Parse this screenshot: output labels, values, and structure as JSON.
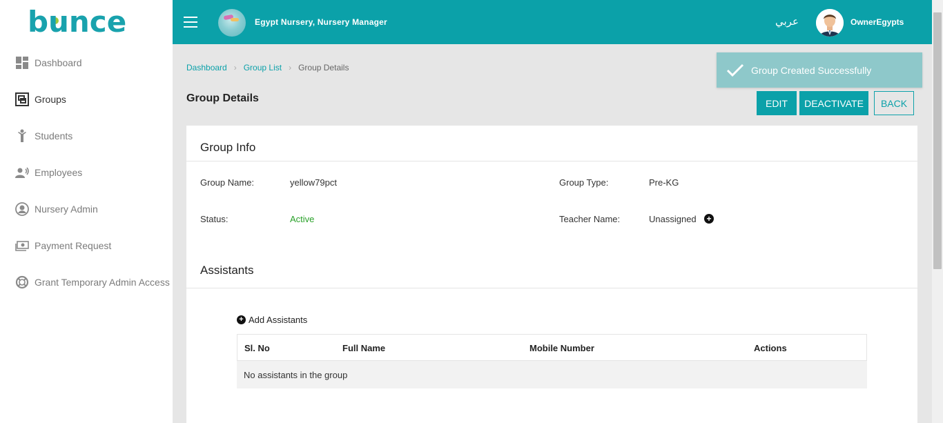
{
  "app": {
    "logo_text": "bounce",
    "nursery_title": "Egypt Nursery, Nursery Manager",
    "language_toggle": "عربي",
    "user_name": "OwnerEgypts"
  },
  "sidebar": {
    "items": [
      {
        "label": "Dashboard",
        "icon": "dashboard-icon"
      },
      {
        "label": "Groups",
        "icon": "groups-icon"
      },
      {
        "label": "Students",
        "icon": "student-icon"
      },
      {
        "label": "Employees",
        "icon": "employee-icon"
      },
      {
        "label": "Nursery Admin",
        "icon": "user-circle-icon"
      },
      {
        "label": "Payment Request",
        "icon": "money-icon"
      },
      {
        "label": "Grant Temporary Admin Access",
        "icon": "lifebuoy-icon"
      }
    ]
  },
  "breadcrumb": {
    "items": [
      "Dashboard",
      "Group List",
      "Group Details"
    ]
  },
  "page": {
    "title": "Group Details"
  },
  "actions": {
    "edit": "EDIT",
    "deactivate": "DEACTIVATE",
    "back": "BACK"
  },
  "toast": {
    "message": "Group Created Successfully"
  },
  "group_info": {
    "title": "Group Info",
    "group_name_label": "Group Name:",
    "group_name_value": "yellow79pct",
    "group_type_label": "Group Type:",
    "group_type_value": "Pre-KG",
    "status_label": "Status:",
    "status_value": "Active",
    "teacher_label": "Teacher Name:",
    "teacher_value": "Unassigned",
    "colors": {
      "accent": "#0ba1a9",
      "active": "#2aa12a"
    }
  },
  "assistants": {
    "title": "Assistants",
    "add_label": "Add Assistants",
    "columns": [
      "Sl. No",
      "Full Name",
      "Mobile Number",
      "Actions"
    ],
    "empty_message": "No assistants in the group"
  }
}
